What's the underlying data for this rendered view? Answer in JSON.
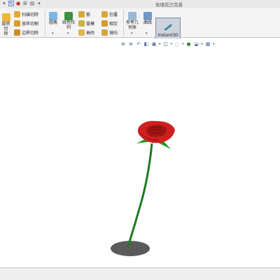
{
  "window": {
    "title": "玫瑰花已完善"
  },
  "quick_access": [
    {
      "name": "undo-dropdown",
      "glyph": "▾"
    },
    {
      "name": "select-pointer",
      "glyph": "↖"
    },
    {
      "name": "traffic-light",
      "glyph": "●"
    },
    {
      "name": "rebuild",
      "glyph": "⊞"
    },
    {
      "name": "options",
      "glyph": "▤"
    },
    {
      "name": "more",
      "glyph": "▾"
    }
  ],
  "ribbon": {
    "group1": {
      "partial_big": {
        "line1": "旋转切",
        "line2": "除"
      },
      "items": [
        "扫描切除",
        "放样切割",
        "边界切除"
      ]
    },
    "group2": {
      "fillet": "圆角",
      "pattern": {
        "line1": "线性阵",
        "line2": "列"
      },
      "items_a": [
        "筋",
        "拔模",
        "抽壳"
      ],
      "items_b": [
        "包覆",
        "相交",
        "镜向"
      ]
    },
    "group3": {
      "ref_geometry": {
        "line1": "参考几",
        "line2": "何体"
      },
      "curves": "曲线",
      "instant3d": "Instant3D"
    }
  },
  "colors": {
    "accent": "#6a8fc8",
    "rose_red": "#d42020",
    "stem_green": "#1e7a1e",
    "leaf_green": "#1f9a24",
    "shadow": "#555555"
  },
  "view_toolbar": [
    "zoom-to-fit",
    "zoom-area",
    "previous-view",
    "section-view",
    "view-orientation",
    "display-style",
    "hide-show",
    "edit-appearance",
    "apply-scene",
    "view-settings"
  ]
}
